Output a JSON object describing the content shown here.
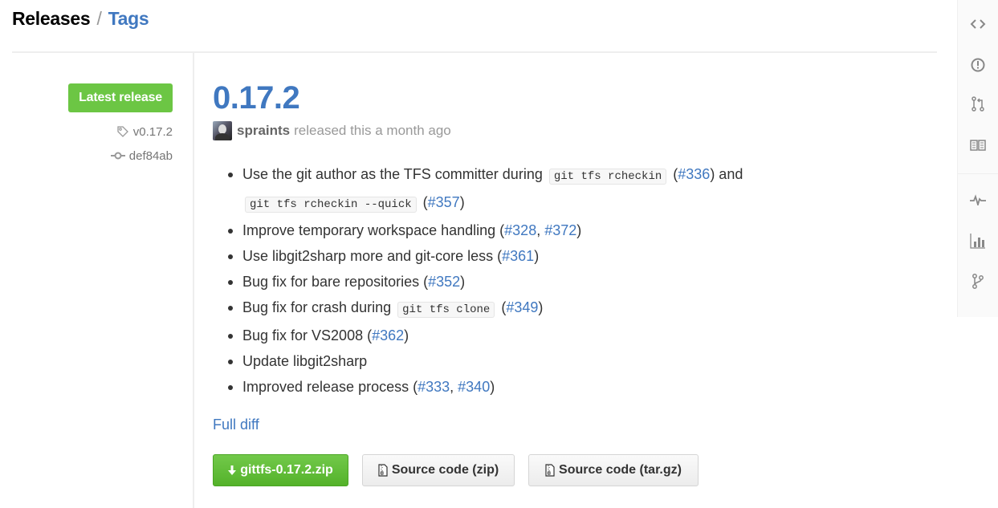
{
  "breadcrumb": {
    "current": "Releases",
    "separator": "/",
    "link": "Tags"
  },
  "meta": {
    "latest_label": "Latest release",
    "tag": "v0.17.2",
    "commit": "def84ab"
  },
  "release": {
    "title": "0.17.2",
    "author": "spraints",
    "released_text": "released this a month ago",
    "notes": [
      {
        "parts": [
          {
            "t": "text",
            "v": "Use the git author as the TFS committer during "
          },
          {
            "t": "code",
            "v": "git tfs rcheckin"
          },
          {
            "t": "text",
            "v": " ("
          },
          {
            "t": "link",
            "v": "#336"
          },
          {
            "t": "text",
            "v": ") and"
          },
          {
            "t": "br"
          },
          {
            "t": "code",
            "v": "git tfs rcheckin --quick"
          },
          {
            "t": "text",
            "v": " ("
          },
          {
            "t": "link",
            "v": "#357"
          },
          {
            "t": "text",
            "v": ")"
          }
        ]
      },
      {
        "parts": [
          {
            "t": "text",
            "v": "Improve temporary workspace handling ("
          },
          {
            "t": "link",
            "v": "#328"
          },
          {
            "t": "text",
            "v": ", "
          },
          {
            "t": "link",
            "v": "#372"
          },
          {
            "t": "text",
            "v": ")"
          }
        ]
      },
      {
        "parts": [
          {
            "t": "text",
            "v": "Use libgit2sharp more and git-core less ("
          },
          {
            "t": "link",
            "v": "#361"
          },
          {
            "t": "text",
            "v": ")"
          }
        ]
      },
      {
        "parts": [
          {
            "t": "text",
            "v": "Bug fix for bare repositories ("
          },
          {
            "t": "link",
            "v": "#352"
          },
          {
            "t": "text",
            "v": ")"
          }
        ]
      },
      {
        "parts": [
          {
            "t": "text",
            "v": "Bug fix for crash during "
          },
          {
            "t": "code",
            "v": "git tfs clone"
          },
          {
            "t": "text",
            "v": " ("
          },
          {
            "t": "link",
            "v": "#349"
          },
          {
            "t": "text",
            "v": ")"
          }
        ]
      },
      {
        "parts": [
          {
            "t": "text",
            "v": "Bug fix for VS2008 ("
          },
          {
            "t": "link",
            "v": "#362"
          },
          {
            "t": "text",
            "v": ")"
          }
        ]
      },
      {
        "parts": [
          {
            "t": "text",
            "v": "Update libgit2sharp"
          }
        ]
      },
      {
        "parts": [
          {
            "t": "text",
            "v": "Improved release process ("
          },
          {
            "t": "link",
            "v": "#333"
          },
          {
            "t": "text",
            "v": ", "
          },
          {
            "t": "link",
            "v": "#340"
          },
          {
            "t": "text",
            "v": ")"
          }
        ]
      }
    ],
    "full_diff_label": "Full diff"
  },
  "downloads": {
    "binary_label": "gittfs-0.17.2.zip",
    "source_zip_label": "Source code (zip)",
    "source_tar_label": "Source code (tar.gz)"
  },
  "sidebar": {
    "icons": [
      "code-icon",
      "issues-icon",
      "pull-request-icon",
      "wiki-icon",
      "pulse-icon",
      "graphs-icon",
      "network-icon"
    ]
  },
  "colors": {
    "link": "#4078c0",
    "success": "#6cc644"
  }
}
